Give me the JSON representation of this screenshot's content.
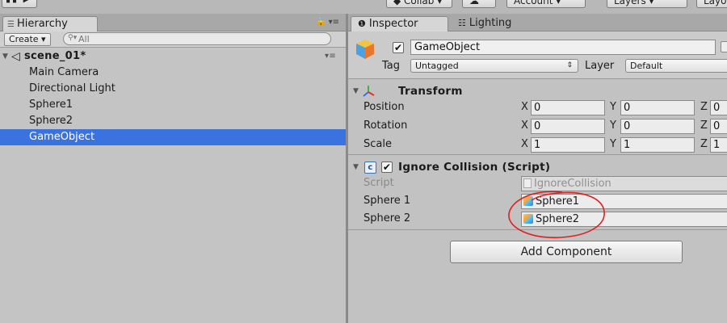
{
  "toolbar": {
    "play_label": "▮▮ ▶",
    "collab_label": "◆ Collab ▾",
    "cloud_label": "☁",
    "account_label": "Account ▾",
    "layers_label": "Layers ▾",
    "layout_label": "Layo"
  },
  "hierarchy": {
    "tab_label": "Hierarchy",
    "tab_menu": "🔒 ▾≡",
    "create_label": "Create ▾",
    "search_placeholder": "All",
    "scene": {
      "name": "scene_01*",
      "menu": "▾≡"
    },
    "items": [
      {
        "label": "Main Camera",
        "selected": false
      },
      {
        "label": "Directional Light",
        "selected": false
      },
      {
        "label": "Sphere1",
        "selected": false
      },
      {
        "label": "Sphere2",
        "selected": false
      },
      {
        "label": "GameObject",
        "selected": true
      }
    ]
  },
  "inspector": {
    "tabs": {
      "inspector": "Inspector",
      "lighting": "Lighting"
    },
    "object": {
      "active": true,
      "name": "GameObject",
      "tag_label": "Tag",
      "tag_value": "Untagged",
      "layer_label": "Layer",
      "layer_value": "Default"
    },
    "transform": {
      "title": "Transform",
      "rows": [
        {
          "label": "Position",
          "x": "0",
          "y": "0",
          "z": "0"
        },
        {
          "label": "Rotation",
          "x": "0",
          "y": "0",
          "z": "0"
        },
        {
          "label": "Scale",
          "x": "1",
          "y": "1",
          "z": "1"
        }
      ],
      "axes": {
        "x": "X",
        "y": "Y",
        "z": "Z"
      }
    },
    "script_component": {
      "title": "Ignore Collision (Script)",
      "enabled": true,
      "script_label": "Script",
      "script_value": "IgnoreCollision",
      "fields": [
        {
          "label": "Sphere 1",
          "value": "Sphere1"
        },
        {
          "label": "Sphere 2",
          "value": "Sphere2"
        }
      ]
    },
    "add_component_label": "Add Component"
  },
  "colors": {
    "selection": "#3a72e0",
    "panel": "#c2c2c2",
    "annotation": "#e02020"
  }
}
